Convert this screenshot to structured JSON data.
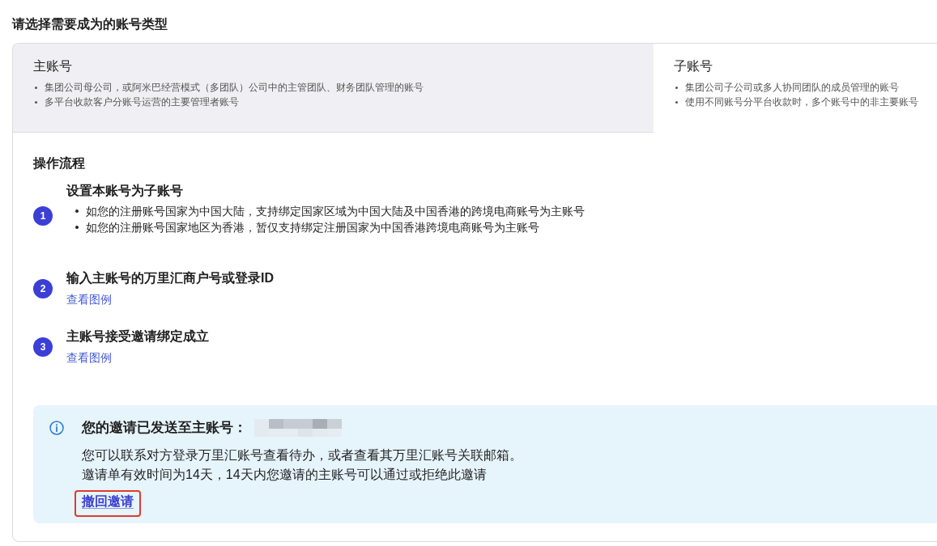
{
  "page_title": "请选择需要成为的账号类型",
  "account_types": [
    {
      "title": "主账号",
      "selected": false,
      "points": [
        "集团公司母公司，或阿米巴经营模式（多团队）公司中的主管团队、财务团队管理的账号",
        "多平台收款客户分账号运营的主要管理者账号"
      ]
    },
    {
      "title": "子账号",
      "selected": true,
      "points": [
        "集团公司子公司或多人协同团队的成员管理的账号",
        "使用不同账号分平台收款时，多个账号中的非主要账号"
      ]
    }
  ],
  "process": {
    "title": "操作流程",
    "steps": [
      {
        "number": "1",
        "title": "设置本账号为子账号",
        "points": [
          "如您的注册账号国家为中国大陆，支持绑定国家区域为中国大陆及中国香港的跨境电商账号为主账号",
          "如您的注册账号国家地区为香港，暂仅支持绑定注册国家为中国香港跨境电商账号为主账号"
        ]
      },
      {
        "number": "2",
        "title": "输入主账号的万里汇商户号或登录ID",
        "link": "查看图例"
      },
      {
        "number": "3",
        "title": "主账号接受邀请绑定成立",
        "link": "查看图例"
      }
    ]
  },
  "notice": {
    "title": "您的邀请已发送至主账号：",
    "lines": [
      "您可以联系对方登录万里汇账号查看待办，或者查看其万里汇账号关联邮箱。",
      "邀请单有效时间为14天，14天内您邀请的主账号可以通过或拒绝此邀请"
    ],
    "action": {
      "label": "撤回邀请",
      "highlighted": true
    }
  }
}
